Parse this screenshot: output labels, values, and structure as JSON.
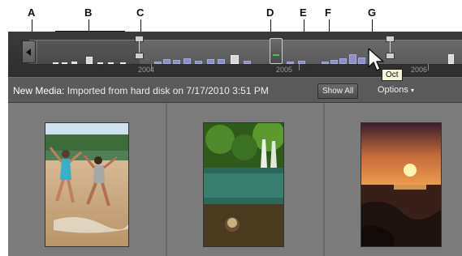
{
  "callouts": {
    "a": "A",
    "b": "B",
    "c": "C",
    "d": "D",
    "e": "E",
    "f": "F",
    "g": "G"
  },
  "timeline": {
    "years": [
      "2004",
      "2005",
      "2006"
    ],
    "tooltip": "Oct"
  },
  "infobar": {
    "label": "New Media:",
    "text": " Imported from hard disk on 7/17/2010 3:51 PM",
    "show_all": "Show All",
    "options": "Options"
  },
  "colors": {
    "bar": "#8b8fc6",
    "bar_selected": "#b8bdf0",
    "marker_grip": "#47c447",
    "panel": "#4a4a4a"
  },
  "thumbnails": [
    {
      "subject": "two girls jumping on a beach"
    },
    {
      "subject": "waterfall over a pool"
    },
    {
      "subject": "sunset over rocky shore"
    }
  ]
}
